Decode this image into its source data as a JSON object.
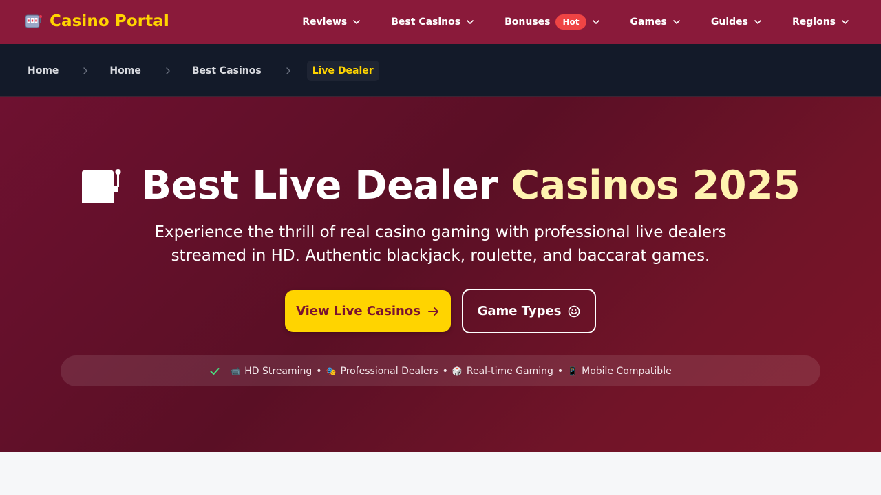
{
  "brand": {
    "name": "Casino Portal",
    "logo_icon": "slot-machine-icon"
  },
  "nav": {
    "items": [
      {
        "label": "Reviews"
      },
      {
        "label": "Best Casinos"
      },
      {
        "label": "Bonuses",
        "badge": "Hot"
      },
      {
        "label": "Games"
      },
      {
        "label": "Guides"
      },
      {
        "label": "Regions"
      }
    ]
  },
  "breadcrumb": {
    "items": [
      "Home",
      "Home",
      "Best Casinos"
    ],
    "current": "Live Dealer"
  },
  "hero": {
    "title_main": "Best Live Dealer",
    "title_highlight": "Casinos 2025",
    "subtitle": "Experience the thrill of real casino gaming with professional live dealers streamed in HD. Authentic blackjack, roulette, and baccarat games.",
    "primary_button": "View Live Casinos",
    "secondary_button": "Game Types",
    "features": [
      {
        "icon": "📹",
        "label": "HD Streaming"
      },
      {
        "icon": "🎭",
        "label": "Professional Dealers"
      },
      {
        "icon": "🎲",
        "label": "Real-time Gaming"
      },
      {
        "icon": "📱",
        "label": "Mobile Compatible"
      }
    ],
    "feature_separator": "•"
  },
  "colors": {
    "nav_bg": "#8a1a3a",
    "brand_accent": "#ffd400",
    "breadcrumb_bg": "#131a29",
    "hot_badge": "#ef4444",
    "hero_bg": "#6e1130",
    "check_green": "#4ade80"
  }
}
